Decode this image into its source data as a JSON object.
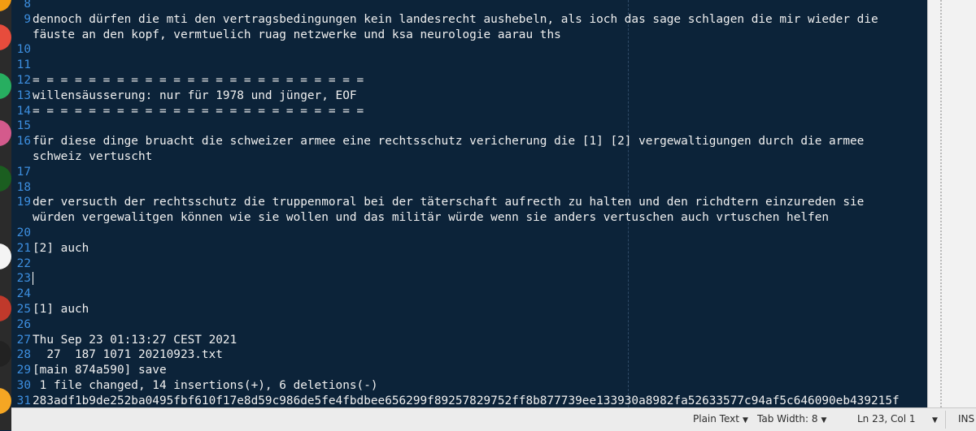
{
  "editor": {
    "lines": [
      {
        "num": "8",
        "text": ""
      },
      {
        "num": "9",
        "text": "dennoch dürfen die mti den vertragsbedingungen kein landesrecht aushebeln, als ioch das sage schlagen die mir wieder die"
      },
      {
        "num": "",
        "text": "fäuste an den kopf, vermtuelich ruag netzwerke und ksa neurologie aarau ths"
      },
      {
        "num": "10",
        "text": ""
      },
      {
        "num": "11",
        "text": ""
      },
      {
        "num": "12",
        "text": "= = = = = = = = = = = = = = = = = = = = = = = ="
      },
      {
        "num": "13",
        "text": "willensäusserung: nur für 1978 und jünger, EOF"
      },
      {
        "num": "14",
        "text": "= = = = = = = = = = = = = = = = = = = = = = = ="
      },
      {
        "num": "15",
        "text": ""
      },
      {
        "num": "16",
        "text": "für diese dinge bruacht die schweizer armee eine rechtsschutz vericherung die [1] [2] vergewaltigungen durch die armee"
      },
      {
        "num": "",
        "text": "schweiz vertuscht"
      },
      {
        "num": "17",
        "text": ""
      },
      {
        "num": "18",
        "text": ""
      },
      {
        "num": "19",
        "text": "der versucth der rechtsschutz die truppenmoral bei der täterschaft aufrecth zu halten und den richdtern einzureden sie"
      },
      {
        "num": "",
        "text": "würden vergewalitgen können wie sie wollen und das militär würde wenn sie anders vertuschen auch vrtuschen helfen"
      },
      {
        "num": "20",
        "text": ""
      },
      {
        "num": "21",
        "text": "[2] auch"
      },
      {
        "num": "22",
        "text": ""
      },
      {
        "num": "23",
        "text": "",
        "cursor": true
      },
      {
        "num": "24",
        "text": ""
      },
      {
        "num": "25",
        "text": "[1] auch"
      },
      {
        "num": "26",
        "text": ""
      },
      {
        "num": "27",
        "text": "Thu Sep 23 01:13:27 CEST 2021"
      },
      {
        "num": "28",
        "text": "  27  187 1071 20210923.txt"
      },
      {
        "num": "29",
        "text": "[main 874a590] save"
      },
      {
        "num": "30",
        "text": " 1 file changed, 14 insertions(+), 6 deletions(-)"
      },
      {
        "num": "31",
        "text": "283adf1b9de252ba0495fbf610f17e8d59c986de5fe4fbdbee656299f89257829752ff8b877739ee133930a8982fa52633577c94af5c646090eb439215f"
      }
    ]
  },
  "statusbar": {
    "language": "Plain Text",
    "tab_width": "Tab Width: 8",
    "position": "Ln 23, Col 1",
    "mode": "INS"
  },
  "dock": {
    "icons": [
      {
        "name": "app-icon-orange",
        "color": "#f39c12"
      },
      {
        "name": "app-icon-red",
        "color": "#e74c3c"
      },
      {
        "name": "app-icon-green",
        "color": "#27ae60"
      },
      {
        "name": "app-icon-pink",
        "color": "#d45a8c"
      },
      {
        "name": "app-icon-circle",
        "color": "#1b5e20"
      },
      {
        "name": "app-icon-white",
        "color": "#f4f4f4"
      },
      {
        "name": "app-icon-red-arrow",
        "color": "#c0392b"
      },
      {
        "name": "app-icon-dark",
        "color": "#222222"
      },
      {
        "name": "app-icon-orange-bottom",
        "color": "#f5a623"
      }
    ]
  }
}
